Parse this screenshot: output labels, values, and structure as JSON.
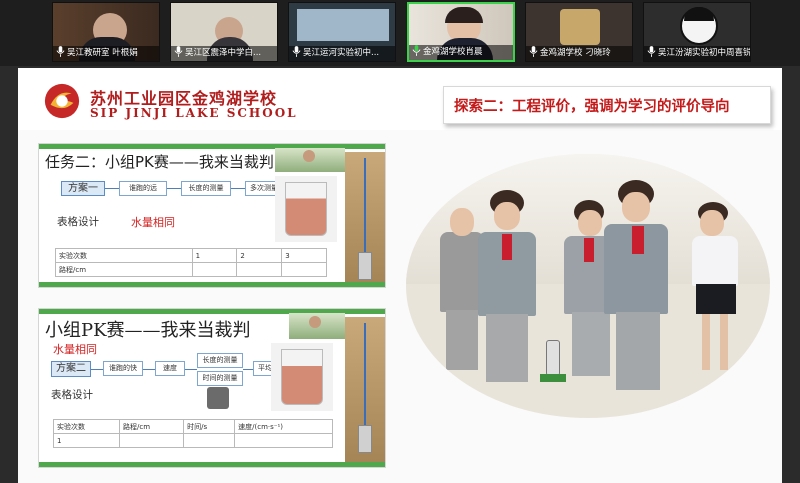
{
  "participants": [
    {
      "name": "吴江教研室 叶根娟",
      "active": false
    },
    {
      "name": "吴江区震泽中学白...",
      "active": false
    },
    {
      "name": "吴江运河实验初中...",
      "active": false
    },
    {
      "name": "金鸡湖学校肖晨",
      "active": true
    },
    {
      "name": "金鸡湖学校 刁晓玲",
      "active": false
    },
    {
      "name": "吴江汾湖实验初中周喜锐",
      "active": false
    }
  ],
  "slide": {
    "school_cn": "苏州工业园区金鸡湖学校",
    "school_en": "SIP JINJI LAKE SCHOOL",
    "title": "探索二：工程评价，强调为学习的评价导向"
  },
  "mini1": {
    "task": "任务二：小组PK赛——我来当裁判",
    "flow_main": "方案一",
    "flow_steps": [
      "谁跑的远",
      "长度的测量",
      "多次测量取平均值"
    ],
    "table_label": "表格设计",
    "note": "水量相同",
    "table_header": [
      "实验次数",
      "1",
      "2",
      "3"
    ],
    "table_row": [
      "路程/cm",
      "",
      "",
      ""
    ]
  },
  "mini2": {
    "task": "小组PK赛——我来当裁判",
    "note": "水量相同",
    "flow_main": "方案二",
    "flow_steps": [
      "谁跑的快",
      "速度",
      "长度的测量",
      "时间的测量",
      "平均速度"
    ],
    "table_label": "表格设计",
    "table_header": [
      "实验次数",
      "路程/cm",
      "时间/s",
      "速度/(cm·s⁻¹)"
    ],
    "table_row": [
      "1",
      "",
      "",
      ""
    ]
  },
  "colors": {
    "brand_red": "#b11d1d",
    "title_red": "#c41a1a",
    "accent_green": "#4fa84b",
    "active_speaker": "#3bd14b"
  }
}
